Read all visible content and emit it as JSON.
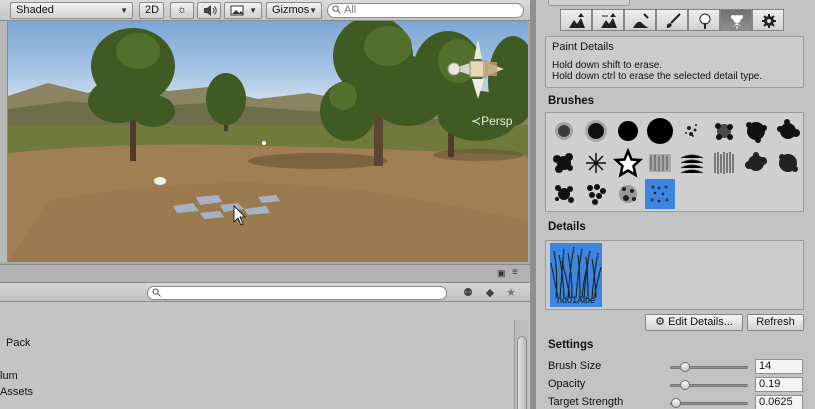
{
  "scene_toolbar": {
    "draw_mode": "Shaded",
    "toggle_2d": "2D",
    "gizmos": "Gizmos",
    "search_placeholder": "All"
  },
  "scene": {
    "camera_label": "Persp"
  },
  "project": {
    "items": [
      "Pack",
      "lum",
      "Assets"
    ]
  },
  "inspector": {
    "paint_details": {
      "title": "Paint Details",
      "hint_shift": "Hold down shift to erase.",
      "hint_ctrl": "Hold down ctrl to erase the selected detail type."
    },
    "brushes_label": "Brushes",
    "details_label": "Details",
    "detail_name": "nd01Albe",
    "edit_details_label": "Edit Details...",
    "refresh_label": "Refresh",
    "settings_label": "Settings",
    "settings": [
      {
        "label": "Brush Size",
        "value": "14",
        "fraction": 0.18
      },
      {
        "label": "Opacity",
        "value": "0.19",
        "fraction": 0.19
      },
      {
        "label": "Target Strength",
        "value": "0.0625",
        "fraction": 0.06
      }
    ]
  },
  "colors": {
    "selection_blue": "#3c85e0",
    "panel_gray": "#c2c2c2"
  }
}
